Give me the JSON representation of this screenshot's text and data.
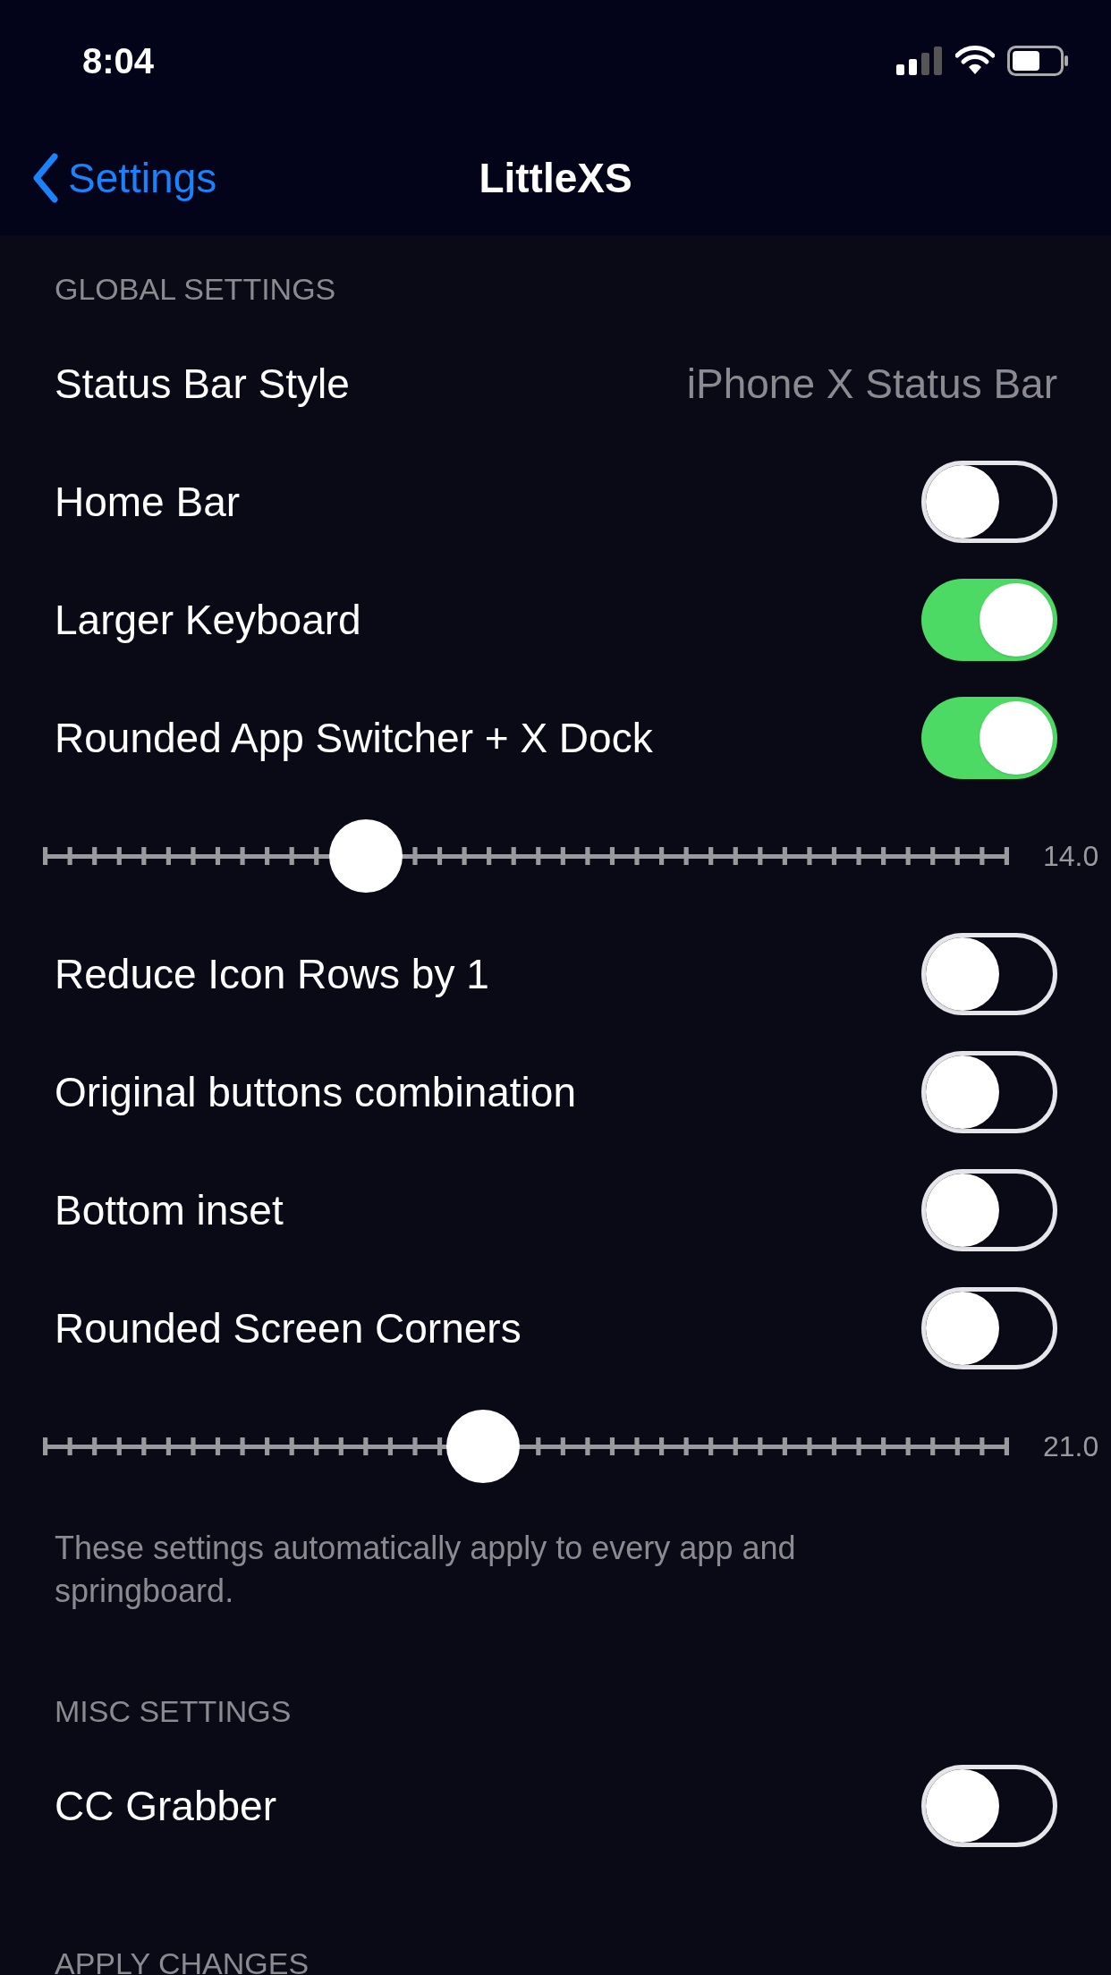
{
  "status_bar": {
    "time": "8:04"
  },
  "nav": {
    "back": "Settings",
    "title": "LittleXS"
  },
  "sections": [
    {
      "header": "GLOBAL SETTINGS",
      "items": [
        {
          "kind": "value",
          "label": "Status Bar Style",
          "value": "iPhone X Status Bar"
        },
        {
          "kind": "toggle",
          "label": "Home Bar",
          "on": false
        },
        {
          "kind": "toggle",
          "label": "Larger Keyboard",
          "on": true
        },
        {
          "kind": "toggle",
          "label": "Rounded App Switcher + X Dock",
          "on": true
        },
        {
          "kind": "slider",
          "level": 0.334,
          "reading": "14.0"
        },
        {
          "kind": "toggle",
          "label": "Reduce Icon Rows by 1",
          "on": false
        },
        {
          "kind": "toggle",
          "label": "Original buttons combination",
          "on": false
        },
        {
          "kind": "toggle",
          "label": "Bottom inset",
          "on": false
        },
        {
          "kind": "toggle",
          "label": "Rounded Screen Corners",
          "on": false
        },
        {
          "kind": "slider",
          "level": 0.456,
          "reading": "21.0"
        }
      ],
      "footer": "These settings automatically apply to every app and springboard."
    },
    {
      "header": "MISC SETTINGS",
      "items": [
        {
          "kind": "toggle",
          "label": "CC Grabber",
          "on": false
        }
      ]
    },
    {
      "header": "APPLY CHANGES"
    }
  ]
}
